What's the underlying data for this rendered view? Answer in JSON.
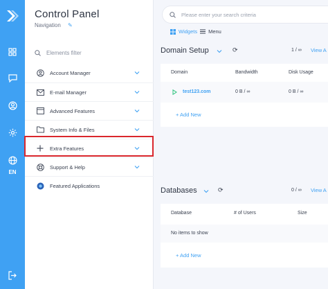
{
  "rail": {
    "lang": "EN"
  },
  "sidebar": {
    "title": "Control Panel",
    "subtitle": "Navigation",
    "filter_placeholder": "Elements filter",
    "items": [
      {
        "label": "Account Manager",
        "icon": "user-circle-icon"
      },
      {
        "label": "E-mail Manager",
        "icon": "envelope-icon"
      },
      {
        "label": "Advanced Features",
        "icon": "window-icon"
      },
      {
        "label": "System Info & Files",
        "icon": "folder-icon"
      },
      {
        "label": "Extra Features",
        "icon": "plus-icon"
      },
      {
        "label": "Support & Help",
        "icon": "lifebuoy-icon"
      },
      {
        "label": "Featured Applications",
        "icon": "apps-icon"
      }
    ]
  },
  "search": {
    "placeholder": "Please enter your search criteria"
  },
  "tabs": {
    "widgets": "Widgets",
    "menu": "Menu"
  },
  "domain_setup": {
    "title": "Domain Setup",
    "page_current": "1",
    "page_sep": "/",
    "page_total": "∞",
    "view_all": "View A",
    "columns": [
      "Domain",
      "Bandwidth",
      "Disk Usage"
    ],
    "rows": [
      {
        "domain": "test123.com",
        "bandwidth": "0 B / ∞",
        "disk": "0 B / ∞"
      }
    ],
    "add_new": "+ Add New"
  },
  "databases": {
    "title": "Databases",
    "page_current": "0",
    "page_sep": "/",
    "page_total": "∞",
    "view_all": "View A",
    "columns": [
      "Database",
      "# of Users",
      "Size"
    ],
    "empty": "No items to show",
    "add_new": "+ Add New"
  },
  "colors": {
    "accent": "#3fa1f3",
    "highlight": "#d9262c"
  }
}
